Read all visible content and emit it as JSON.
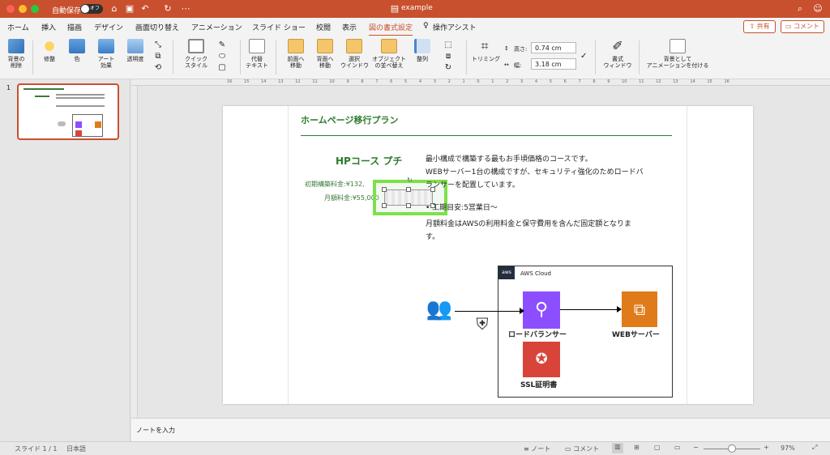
{
  "titlebar": {
    "autosave_label": "自動保存",
    "autosave_state": "オフ",
    "doc_title": "example"
  },
  "tabs": [
    "ホーム",
    "挿入",
    "描画",
    "デザイン",
    "画面切り替え",
    "アニメーション",
    "スライド ショー",
    "校閲",
    "表示",
    "図の書式設定",
    "操作アシスト"
  ],
  "share": {
    "share_label": "共有",
    "comment_label": "コメント"
  },
  "ribbon": {
    "remove_bg": "背景の\n削除",
    "correct": "修整",
    "color": "色",
    "art": "アート\n効果",
    "transparency": "透明度",
    "quick_style": "クイック\nスタイル",
    "alt_text": "代替\nテキスト",
    "bring_forward": "前面へ\n移動",
    "send_back": "背面へ\n移動",
    "select_window": "選択\nウインドウ",
    "reorder": "オブジェクト\nの並べ替え",
    "align": "整列",
    "crop": "トリミング",
    "height_label": "高さ:",
    "height_value": "0.74 cm",
    "width_label": "幅:",
    "width_value": "3.18 cm",
    "format_window": "書式\nウィンドウ",
    "bg_animation": "背景として\nアニメーションを付ける"
  },
  "slide_number": "1",
  "ruler_marks": [
    "16",
    "15",
    "14",
    "13",
    "12",
    "11",
    "10",
    "9",
    "8",
    "7",
    "6",
    "5",
    "4",
    "3",
    "2",
    "1",
    "0",
    "1",
    "2",
    "3",
    "4",
    "5",
    "6",
    "7",
    "8",
    "9",
    "10",
    "11",
    "12",
    "13",
    "14",
    "15",
    "16"
  ],
  "slide": {
    "title": "ホームページ移行プラン",
    "course_name": "HPコース プチ",
    "initial_fee": "初期構築料金:¥132,",
    "monthly_fee": "月額料金:¥55,000",
    "desc1": "最小構成で構築する最もお手頃価格のコースです。",
    "desc2": "WEBサーバー1台の構成ですが、セキュリティ強化のためロードバ",
    "desc3": "ランサーを配置しています。",
    "bullet": "工期目安:5営業日〜",
    "desc4": "月額料金はAWSの利用料金と保守費用を含んだ固定額となりま",
    "desc5": "す。",
    "aws_cloud": "AWS Cloud",
    "aws_tag": "aws",
    "lb_label": "ロードバランサー",
    "web_label": "WEBサーバー",
    "ssl_label": "SSL証明書"
  },
  "notes_placeholder": "ノートを入力",
  "status": {
    "slide_info": "スライド 1 / 1",
    "language": "日本語",
    "notes_btn": "ノート",
    "comments_btn": "コメント",
    "zoom": "97%"
  },
  "colors": {
    "accent": "#c8502e",
    "green": "#2e7a2e",
    "selection": "#7ee04a",
    "aws_purple": "#8c4fff",
    "aws_orange": "#e07b1a",
    "aws_red": "#d9443a"
  }
}
